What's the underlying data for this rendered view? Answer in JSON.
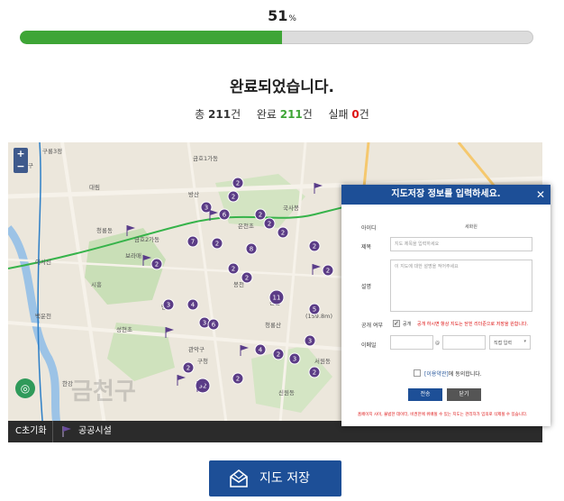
{
  "progress": {
    "percent_value": "51",
    "percent_unit": "%",
    "fraction": 0.51,
    "fill_color": "#3ea536"
  },
  "status": {
    "title": "완료되었습니다.",
    "total_label": "총",
    "total_value": "211",
    "total_unit": "건",
    "complete_label": "완료",
    "complete_value": "211",
    "complete_unit": "건",
    "fail_label": "실패",
    "fail_value": "0",
    "fail_unit": "건"
  },
  "map": {
    "zoom_in": "+",
    "zoom_out": "−",
    "place_labels": [
      "구룡3정",
      "금호구",
      "대림",
      "금호1가동",
      "청룡동",
      "금호2가동",
      "이사선",
      "시흥",
      "백운천",
      "한강",
      "방산",
      "보라매",
      "국사봉",
      "은천초",
      "성현초",
      "신림",
      "봉천",
      "당곡",
      "청룡산",
      "관악구",
      "구청",
      "신원동",
      "서원동",
      "(159.8m)"
    ],
    "area_watermark": "금천구",
    "cluster_counts": [
      "2",
      "2",
      "3",
      "6",
      "2",
      "7",
      "2",
      "8",
      "2",
      "2",
      "2",
      "2",
      "3",
      "4",
      "2",
      "2",
      "11",
      "2",
      "5",
      "3",
      "6",
      "4",
      "2",
      "3",
      "3",
      "32",
      "2",
      "2",
      "2"
    ],
    "footer": {
      "reset_label": "C초기화",
      "legend_label": "공공시설"
    }
  },
  "modal": {
    "title": "지도저장 정보를 입력하세요.",
    "close_icon": "close-icon",
    "author_label": "아이디",
    "author_value": "세화원",
    "title_label": "제목",
    "title_placeholder": "지도 제목을 입력하세요",
    "desc_label": "설명",
    "desc_placeholder": "이 지도에 대한 설명을 적어주세요",
    "public_label": "공개 여부",
    "public_option": "공개",
    "public_note": "공개 하시면 항상 지도는 닫힌 리더준으로 저장을 원합니다.",
    "password_label": "이메일",
    "password_sep": "@",
    "select_value": "직접 입력",
    "agree_link": "[이용약관]",
    "agree_text": "에 동의합니다.",
    "send_label": "전송",
    "close_label": "닫기",
    "bottom_note": "홈페이지 사이, 불법한 데이터, 비권한에 위배될 수 있는 지도는 관리자가 임의로 삭제될 수 있습니다."
  },
  "save_button": {
    "label": "지도 저장",
    "icon": "envelope-icon"
  },
  "colors": {
    "primary": "#1d4f97",
    "success": "#3ea536",
    "danger": "#d11111",
    "cluster": "#5b3c86"
  }
}
